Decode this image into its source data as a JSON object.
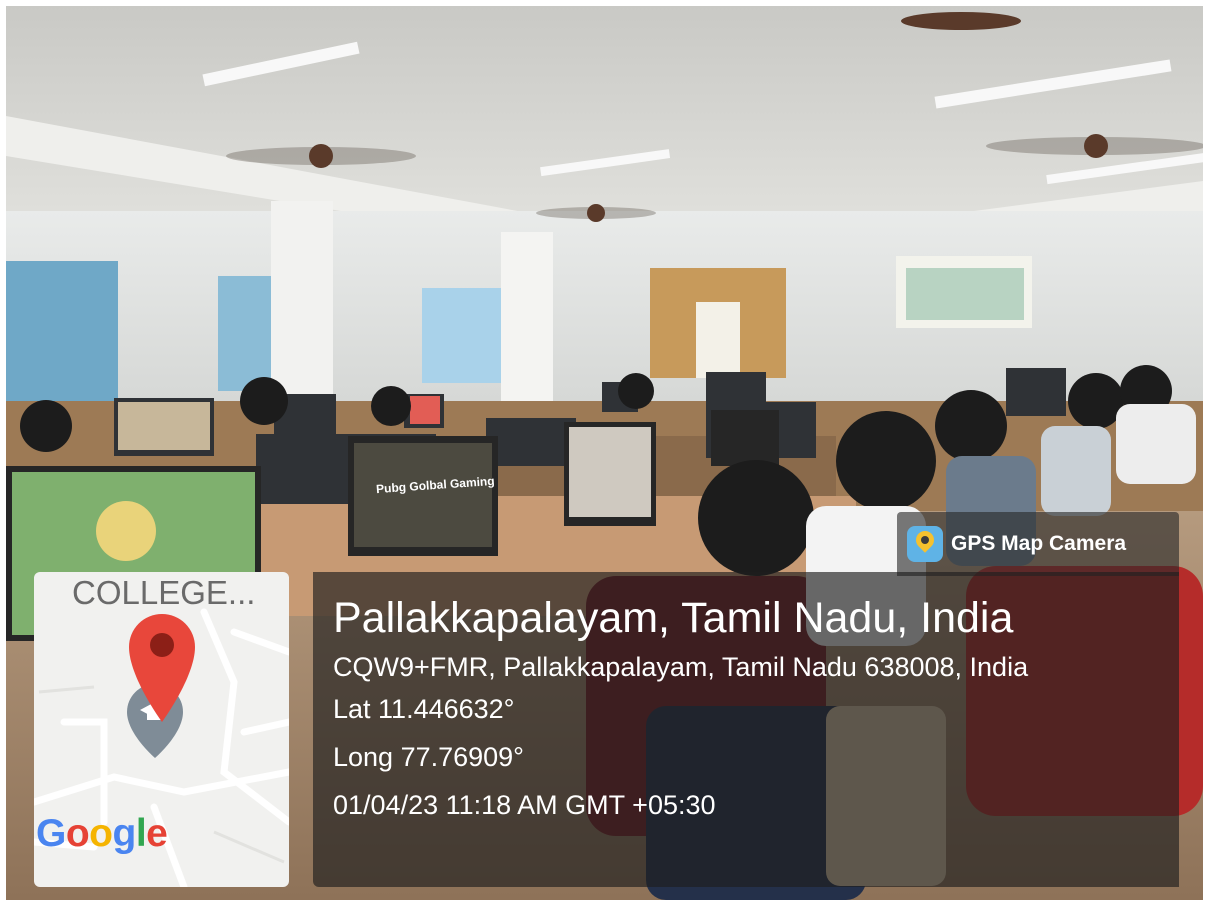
{
  "photo": {
    "monitor_caption": "Pubg Golbal Gaming"
  },
  "overlay": {
    "app_name": "GPS Map Camera",
    "app_icon": "gps-map-camera-icon",
    "map": {
      "place_label": "COLLEGE...",
      "pin_icon": "map-pin-icon",
      "marker_icon": "graduation-cap-marker-icon",
      "google_logo": "Google",
      "pin_color": "#e8473b",
      "marker_color": "#7f8c97"
    },
    "location_title": "Pallakkapalayam, Tamil Nadu, India",
    "address": "CQW9+FMR, Pallakkapalayam, Tamil Nadu 638008, India",
    "latitude": "Lat 11.446632°",
    "longitude": "Long 77.76909°",
    "datetime": "01/04/23 11:18 AM GMT +05:30"
  }
}
